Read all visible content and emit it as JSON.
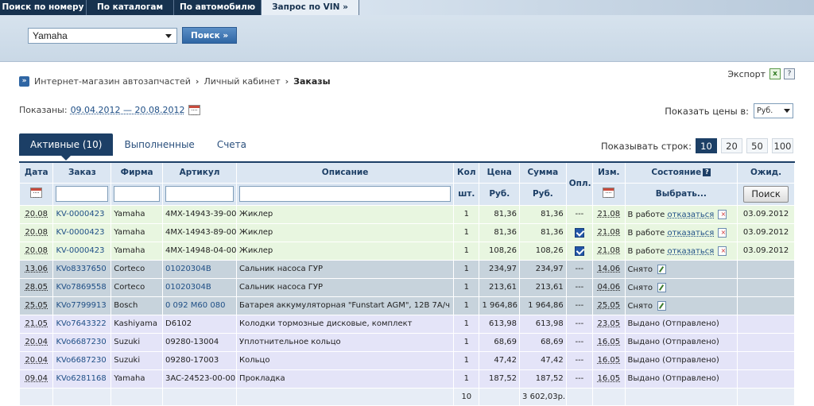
{
  "top_tabs": [
    {
      "label": "Поиск по номеру",
      "active": false
    },
    {
      "label": "По каталогам",
      "active": false
    },
    {
      "label": "По автомобилю",
      "active": false
    },
    {
      "label": "Запрос по VIN »",
      "active": true
    }
  ],
  "search": {
    "brand_value": "Yamaha",
    "button_label": "Поиск »"
  },
  "breadcrumb": {
    "items": [
      "Интернет-магазин автозапчастей",
      "Личный кабинет"
    ],
    "current": "Заказы"
  },
  "export": {
    "label": "Экспорт"
  },
  "period": {
    "label": "Показаны:",
    "range": "09.04.2012 — 20.08.2012"
  },
  "currency": {
    "label": "Показать цены в:",
    "value": "Руб."
  },
  "order_tabs": [
    {
      "label": "Активные (10)",
      "active": true
    },
    {
      "label": "Выполненные",
      "active": false
    },
    {
      "label": "Счета",
      "active": false
    }
  ],
  "rows_per_page": {
    "label": "Показывать строк:",
    "options": [
      "10",
      "20",
      "50",
      "100"
    ],
    "selected": "10"
  },
  "table": {
    "headers": {
      "date": "Дата",
      "order": "Заказ",
      "firm": "Фирма",
      "article": "Артикул",
      "description": "Описание",
      "qty": "Кол",
      "qty_unit": "шт.",
      "price": "Цена",
      "price_unit": "Руб.",
      "sum": "Сумма",
      "sum_unit": "Руб.",
      "paid": "Опл.",
      "changed": "Изм.",
      "state": "Состояние",
      "state_filter": "Выбрать...",
      "expected": "Ожид.",
      "filter_button": "Поиск"
    },
    "rows": [
      {
        "status": "green",
        "date": "20.08",
        "order": "KV-0000423",
        "firm": "Yamaha",
        "article": "4MX-14943-39-00",
        "article_link": false,
        "description": "Жиклер",
        "qty": "1",
        "price": "81,36",
        "sum": "81,36",
        "paid": "---",
        "changed": "21.08",
        "state": "В работе",
        "action": "отказаться",
        "action_icon": "cancel",
        "expected": "03.09.2012"
      },
      {
        "status": "green",
        "date": "20.08",
        "order": "KV-0000423",
        "firm": "Yamaha",
        "article": "4MX-14943-89-00",
        "article_link": false,
        "description": "Жиклер",
        "qty": "1",
        "price": "81,36",
        "sum": "81,36",
        "paid": "checked",
        "changed": "21.08",
        "state": "В работе",
        "action": "отказаться",
        "action_icon": "cancel",
        "expected": "03.09.2012"
      },
      {
        "status": "green",
        "date": "20.08",
        "order": "KV-0000423",
        "firm": "Yamaha",
        "article": "4MX-14948-04-00",
        "article_link": false,
        "description": "Жиклер",
        "qty": "1",
        "price": "108,26",
        "sum": "108,26",
        "paid": "checked",
        "changed": "21.08",
        "state": "В работе",
        "action": "отказаться",
        "action_icon": "cancel",
        "expected": "03.09.2012"
      },
      {
        "status": "gray",
        "date": "13.06",
        "order": "KVo8337650",
        "firm": "Corteco",
        "article": "01020304B",
        "article_link": true,
        "description": "Сальник насоса ГУР",
        "qty": "1",
        "price": "234,97",
        "sum": "234,97",
        "paid": "---",
        "changed": "14.06",
        "state": "Снято",
        "action": "",
        "action_icon": "edit",
        "expected": ""
      },
      {
        "status": "gray",
        "date": "28.05",
        "order": "KVo7869558",
        "firm": "Corteco",
        "article": "01020304B",
        "article_link": true,
        "description": "Сальник насоса ГУР",
        "qty": "1",
        "price": "213,61",
        "sum": "213,61",
        "paid": "---",
        "changed": "04.06",
        "state": "Снято",
        "action": "",
        "action_icon": "edit",
        "expected": ""
      },
      {
        "status": "gray",
        "date": "25.05",
        "order": "KVo7799913",
        "firm": "Bosch",
        "article": "0 092 M60 080",
        "article_link": true,
        "description": "Батарея аккумуляторная \"Funstart AGM\", 12В 7А/ч",
        "qty": "1",
        "price": "1 964,86",
        "sum": "1 964,86",
        "paid": "---",
        "changed": "25.05",
        "state": "Снято",
        "action": "",
        "action_icon": "edit",
        "expected": ""
      },
      {
        "status": "lav",
        "date": "21.05",
        "order": "KVo7643322",
        "firm": "Kashiyama",
        "article": "D6102",
        "article_link": false,
        "description": "Колодки тормозные дисковые, комплект",
        "qty": "1",
        "price": "613,98",
        "sum": "613,98",
        "paid": "---",
        "changed": "23.05",
        "state": "Выдано (Отправлено)",
        "action": "",
        "action_icon": "",
        "expected": ""
      },
      {
        "status": "lav",
        "date": "20.04",
        "order": "KVo6687230",
        "firm": "Suzuki",
        "article": "09280-13004",
        "article_link": false,
        "description": "Уплотнительное кольцо",
        "qty": "1",
        "price": "68,69",
        "sum": "68,69",
        "paid": "---",
        "changed": "16.05",
        "state": "Выдано (Отправлено)",
        "action": "",
        "action_icon": "",
        "expected": ""
      },
      {
        "status": "lav",
        "date": "20.04",
        "order": "KVo6687230",
        "firm": "Suzuki",
        "article": "09280-17003",
        "article_link": false,
        "description": "Кольцо",
        "qty": "1",
        "price": "47,42",
        "sum": "47,42",
        "paid": "---",
        "changed": "16.05",
        "state": "Выдано (Отправлено)",
        "action": "",
        "action_icon": "",
        "expected": ""
      },
      {
        "status": "lav",
        "date": "09.04",
        "order": "KVo6281168",
        "firm": "Yamaha",
        "article": "3AC-24523-00-00",
        "article_link": false,
        "description": "Прокладка",
        "qty": "1",
        "price": "187,52",
        "sum": "187,52",
        "paid": "---",
        "changed": "16.05",
        "state": "Выдано (Отправлено)",
        "action": "",
        "action_icon": "",
        "expected": ""
      }
    ],
    "totals": {
      "qty": "10",
      "sum": "3 602,03р."
    }
  }
}
